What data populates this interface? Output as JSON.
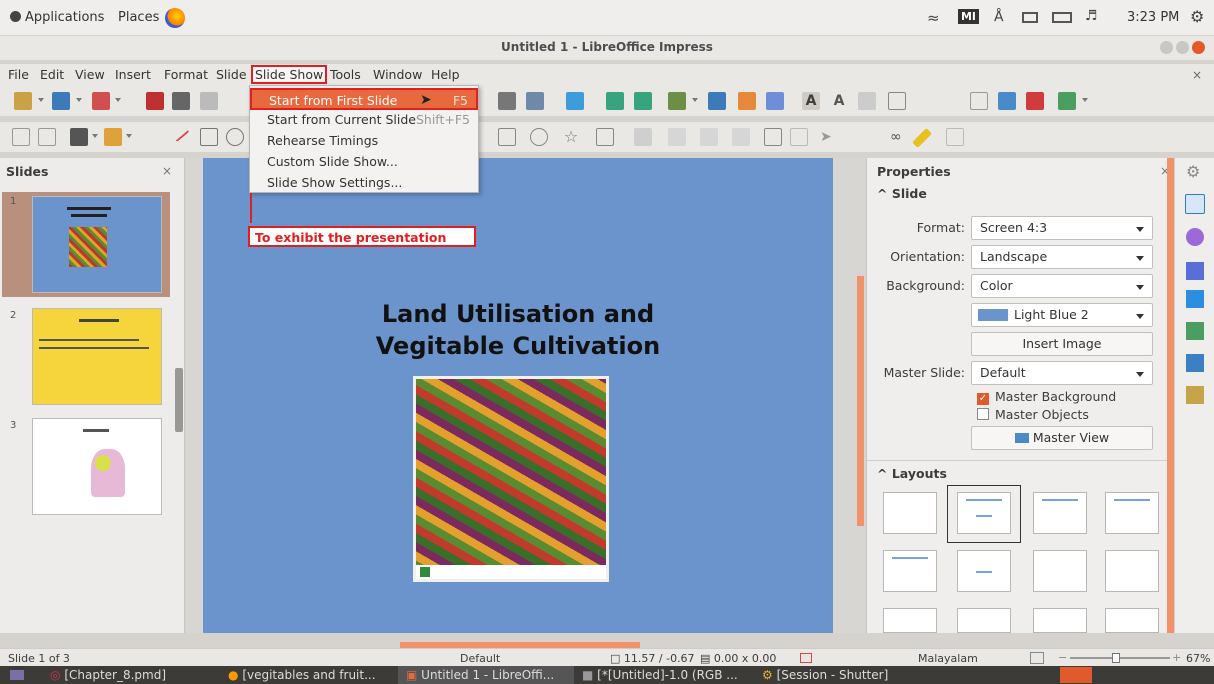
{
  "top_bar": {
    "applications": "Applications",
    "places": "Places",
    "ml_badge": "Ml",
    "clock": "3:23 PM"
  },
  "window": {
    "title": "Untitled 1 - LibreOffice Impress"
  },
  "menubar": [
    "File",
    "Edit",
    "View",
    "Insert",
    "Format",
    "Slide",
    "Slide Show",
    "Tools",
    "Window",
    "Help"
  ],
  "slide_show_menu": {
    "items": [
      {
        "label": "Start from First Slide",
        "shortcut": "F5"
      },
      {
        "label": "Start from Current Slide",
        "shortcut": "Shift+F5"
      },
      {
        "label": "Rehearse Timings",
        "shortcut": ""
      },
      {
        "label": "Custom Slide Show...",
        "shortcut": ""
      },
      {
        "label": "Slide Show Settings...",
        "shortcut": ""
      }
    ],
    "annotation": "To exhibit the presentation"
  },
  "slides_panel": {
    "title": "Slides",
    "close": "×",
    "thumbs": [
      {
        "num": "1"
      },
      {
        "num": "2"
      },
      {
        "num": "3"
      }
    ]
  },
  "slide": {
    "title_line1": "Land Utilisation and",
    "title_line2": "Vegitable Cultivation"
  },
  "properties": {
    "header": "Properties",
    "close": "×",
    "slide_section": "Slide",
    "format_label": "Format:",
    "format_value": "Screen 4:3",
    "orientation_label": "Orientation:",
    "orientation_value": "Landscape",
    "background_label": "Background:",
    "background_value": "Color",
    "color_value": "Light Blue 2",
    "insert_image": "Insert Image",
    "master_slide_label": "Master Slide:",
    "master_slide_value": "Default",
    "master_background": "Master Background",
    "master_objects": "Master Objects",
    "master_view": "Master View",
    "layouts_section": "Layouts"
  },
  "status": {
    "slide_info": "Slide 1 of 3",
    "master": "Default",
    "position": "11.57 / -0.67",
    "size": "0.00 x 0.00",
    "language": "Malayalam",
    "zoom": "67%"
  },
  "taskbar": {
    "items": [
      "[Chapter_8.pmd]",
      "[vegitables and fruit...",
      "Untitled 1 - LibreOffi...",
      "[*[Untitled]-1.0 (RGB ...",
      "[Session - Shutter]"
    ]
  },
  "colors": {
    "accent_red": "#e0201e",
    "menu_highlight": "#e8693d",
    "slide_bg": "#6b93cc",
    "orange_bar": "#f0936a"
  }
}
